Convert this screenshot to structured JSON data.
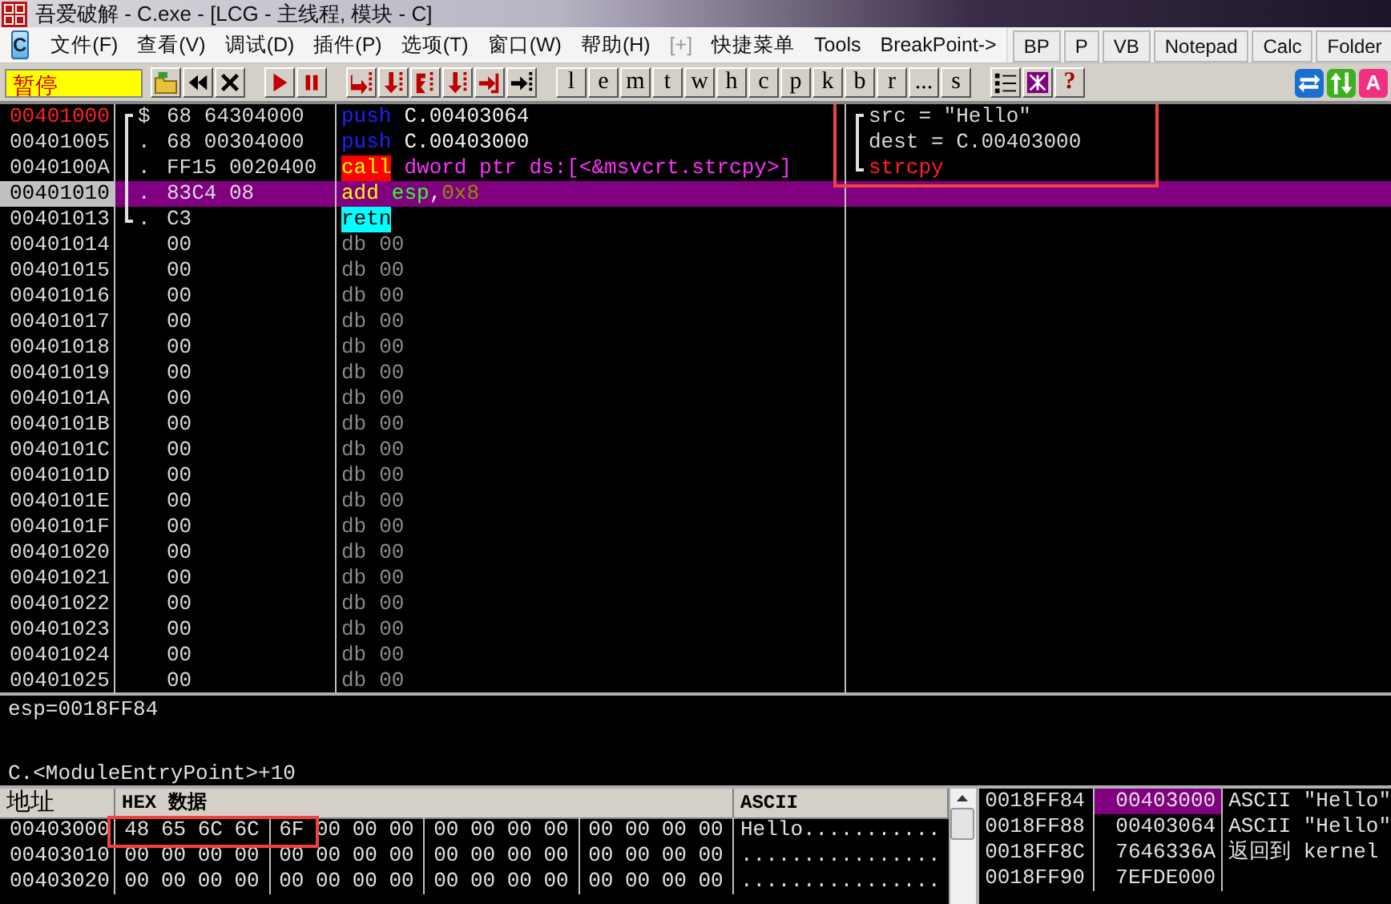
{
  "window": {
    "title": "吾爱破解 - C.exe - [LCG -  主线程, 模块 - C]"
  },
  "menu": {
    "app_icon": "C",
    "items": [
      {
        "label": "文件(F)",
        "disabled": false
      },
      {
        "label": "查看(V)",
        "disabled": false
      },
      {
        "label": "调试(D)",
        "disabled": false
      },
      {
        "label": "插件(P)",
        "disabled": false
      },
      {
        "label": "选项(T)",
        "disabled": false
      },
      {
        "label": "窗口(W)",
        "disabled": false
      },
      {
        "label": "帮助(H)",
        "disabled": false
      },
      {
        "label": "[+]",
        "disabled": true
      },
      {
        "label": "快捷菜单",
        "disabled": false
      },
      {
        "label": "Tools",
        "disabled": false
      },
      {
        "label": "BreakPoint->",
        "disabled": false
      }
    ]
  },
  "quick_buttons": [
    "BP",
    "P",
    "VB",
    "Notepad",
    "Calc",
    "Folder"
  ],
  "toolbar": {
    "status": "暂停",
    "groups": [
      [
        {
          "kind": "open"
        },
        {
          "kind": "restart"
        },
        {
          "kind": "close"
        }
      ],
      [
        {
          "kind": "run"
        },
        {
          "kind": "pause"
        }
      ],
      [
        {
          "kind": "step_into"
        },
        {
          "kind": "step_over"
        },
        {
          "kind": "trace_into"
        },
        {
          "kind": "trace_over"
        },
        {
          "kind": "till_return"
        },
        {
          "kind": "goto"
        }
      ],
      [
        {
          "kind": "letter",
          "label": "l"
        },
        {
          "kind": "letter",
          "label": "e"
        },
        {
          "kind": "letter",
          "label": "m"
        },
        {
          "kind": "letter",
          "label": "t"
        },
        {
          "kind": "letter",
          "label": "w"
        },
        {
          "kind": "letter",
          "label": "h"
        },
        {
          "kind": "letter",
          "label": "c"
        },
        {
          "kind": "letter",
          "label": "p"
        },
        {
          "kind": "letter",
          "label": "k"
        },
        {
          "kind": "letter",
          "label": "b"
        },
        {
          "kind": "letter",
          "label": "r"
        },
        {
          "kind": "letter",
          "label": "..."
        },
        {
          "kind": "letter",
          "label": "s"
        }
      ],
      [
        {
          "kind": "list"
        },
        {
          "kind": "grid"
        },
        {
          "kind": "help",
          "label": "?"
        }
      ]
    ],
    "right_icons": [
      {
        "kind": "swap"
      },
      {
        "kind": "updown"
      },
      {
        "kind": "badge",
        "label": "A"
      }
    ]
  },
  "disassembly": {
    "rows": [
      {
        "address": "00401000",
        "marked": true,
        "selected": false,
        "bracket": {
          "kind": "top"
        },
        "marker": "$",
        "hex": "68 64304000",
        "tokens": [
          {
            "text": "push",
            "kind": "push"
          },
          {
            "text": "C.00403064",
            "kind": "operand"
          }
        ],
        "comment": {
          "text": "src = \"Hello\"",
          "kind": "arg",
          "bracket": {
            "kind": "top"
          }
        }
      },
      {
        "address": "00401005",
        "marked": false,
        "selected": false,
        "bracket": {
          "kind": "middle"
        },
        "marker": ".",
        "hex": "68 00304000",
        "tokens": [
          {
            "text": "push",
            "kind": "push"
          },
          {
            "text": "C.00403000",
            "kind": "operand"
          }
        ],
        "comment": {
          "text": "dest = C.00403000",
          "kind": "arg",
          "bracket": {
            "kind": "middle"
          }
        }
      },
      {
        "address": "0040100A",
        "marked": false,
        "selected": false,
        "bracket": {
          "kind": "middle"
        },
        "marker": ".",
        "hex": "FF15 0020400",
        "tokens": [
          {
            "text": "call",
            "kind": "call"
          },
          {
            "text": "dword ptr ds:[<&msvcrt.strcpy>]",
            "kind": "api"
          }
        ],
        "comment": {
          "text": "strcpy",
          "kind": "call",
          "bracket": {
            "kind": "bottom"
          }
        }
      },
      {
        "address": "00401010",
        "marked": false,
        "selected": true,
        "bracket": {
          "kind": "middle"
        },
        "marker": ".",
        "hex": "83C4 08",
        "tokens": [
          {
            "text": "add",
            "kind": "arith"
          },
          {
            "text": "esp",
            "kind": "register"
          },
          {
            "text": ",",
            "kind": "operand"
          },
          {
            "text": "0x8",
            "kind": "immediate"
          }
        ]
      },
      {
        "address": "00401013",
        "marked": false,
        "selected": false,
        "bracket": {
          "kind": "bottom"
        },
        "marker": ".",
        "hex": "C3",
        "tokens": [
          {
            "text": "retn",
            "kind": "return"
          }
        ]
      },
      {
        "address": "00401014",
        "marked": false,
        "selected": false,
        "hex": "00",
        "tokens": [
          {
            "text": "db",
            "kind": "data"
          },
          {
            "text": "00",
            "kind": "data"
          }
        ]
      },
      {
        "address": "00401015",
        "marked": false,
        "selected": false,
        "hex": "00",
        "tokens": [
          {
            "text": "db",
            "kind": "data"
          },
          {
            "text": "00",
            "kind": "data"
          }
        ]
      },
      {
        "address": "00401016",
        "marked": false,
        "selected": false,
        "hex": "00",
        "tokens": [
          {
            "text": "db",
            "kind": "data"
          },
          {
            "text": "00",
            "kind": "data"
          }
        ]
      },
      {
        "address": "00401017",
        "marked": false,
        "selected": false,
        "hex": "00",
        "tokens": [
          {
            "text": "db",
            "kind": "data"
          },
          {
            "text": "00",
            "kind": "data"
          }
        ]
      },
      {
        "address": "00401018",
        "marked": false,
        "selected": false,
        "hex": "00",
        "tokens": [
          {
            "text": "db",
            "kind": "data"
          },
          {
            "text": "00",
            "kind": "data"
          }
        ]
      },
      {
        "address": "00401019",
        "marked": false,
        "selected": false,
        "hex": "00",
        "tokens": [
          {
            "text": "db",
            "kind": "data"
          },
          {
            "text": "00",
            "kind": "data"
          }
        ]
      },
      {
        "address": "0040101A",
        "marked": false,
        "selected": false,
        "hex": "00",
        "tokens": [
          {
            "text": "db",
            "kind": "data"
          },
          {
            "text": "00",
            "kind": "data"
          }
        ]
      },
      {
        "address": "0040101B",
        "marked": false,
        "selected": false,
        "hex": "00",
        "tokens": [
          {
            "text": "db",
            "kind": "data"
          },
          {
            "text": "00",
            "kind": "data"
          }
        ]
      },
      {
        "address": "0040101C",
        "marked": false,
        "selected": false,
        "hex": "00",
        "tokens": [
          {
            "text": "db",
            "kind": "data"
          },
          {
            "text": "00",
            "kind": "data"
          }
        ]
      },
      {
        "address": "0040101D",
        "marked": false,
        "selected": false,
        "hex": "00",
        "tokens": [
          {
            "text": "db",
            "kind": "data"
          },
          {
            "text": "00",
            "kind": "data"
          }
        ]
      },
      {
        "address": "0040101E",
        "marked": false,
        "selected": false,
        "hex": "00",
        "tokens": [
          {
            "text": "db",
            "kind": "data"
          },
          {
            "text": "00",
            "kind": "data"
          }
        ]
      },
      {
        "address": "0040101F",
        "marked": false,
        "selected": false,
        "hex": "00",
        "tokens": [
          {
            "text": "db",
            "kind": "data"
          },
          {
            "text": "00",
            "kind": "data"
          }
        ]
      },
      {
        "address": "00401020",
        "marked": false,
        "selected": false,
        "hex": "00",
        "tokens": [
          {
            "text": "db",
            "kind": "data"
          },
          {
            "text": "00",
            "kind": "data"
          }
        ]
      },
      {
        "address": "00401021",
        "marked": false,
        "selected": false,
        "hex": "00",
        "tokens": [
          {
            "text": "db",
            "kind": "data"
          },
          {
            "text": "00",
            "kind": "data"
          }
        ]
      },
      {
        "address": "00401022",
        "marked": false,
        "selected": false,
        "hex": "00",
        "tokens": [
          {
            "text": "db",
            "kind": "data"
          },
          {
            "text": "00",
            "kind": "data"
          }
        ]
      },
      {
        "address": "00401023",
        "marked": false,
        "selected": false,
        "hex": "00",
        "tokens": [
          {
            "text": "db",
            "kind": "data"
          },
          {
            "text": "00",
            "kind": "data"
          }
        ]
      },
      {
        "address": "00401024",
        "marked": false,
        "selected": false,
        "hex": "00",
        "tokens": [
          {
            "text": "db",
            "kind": "data"
          },
          {
            "text": "00",
            "kind": "data"
          }
        ]
      },
      {
        "address": "00401025",
        "marked": false,
        "selected": false,
        "hex": "00",
        "tokens": [
          {
            "text": "db",
            "kind": "data"
          },
          {
            "text": "00",
            "kind": "data"
          }
        ]
      }
    ]
  },
  "info": [
    "esp=0018FF84",
    "C.<ModuleEntryPoint>+10"
  ],
  "dump": {
    "columns": [
      "地址",
      "HEX 数据",
      "ASCII"
    ],
    "rows": [
      {
        "address": "00403000",
        "bytes": [
          "48",
          "65",
          "6C",
          "6C",
          "6F",
          "00",
          "00",
          "00",
          "00",
          "00",
          "00",
          "00",
          "00",
          "00",
          "00",
          "00"
        ],
        "ascii": "Hello..........."
      },
      {
        "address": "00403010",
        "bytes": [
          "00",
          "00",
          "00",
          "00",
          "00",
          "00",
          "00",
          "00",
          "00",
          "00",
          "00",
          "00",
          "00",
          "00",
          "00",
          "00"
        ],
        "ascii": "................"
      },
      {
        "address": "00403020",
        "bytes": [
          "00",
          "00",
          "00",
          "00",
          "00",
          "00",
          "00",
          "00",
          "00",
          "00",
          "00",
          "00",
          "00",
          "00",
          "00",
          "00"
        ],
        "ascii": "................"
      }
    ]
  },
  "stack": {
    "rows": [
      {
        "address": "0018FF84",
        "value": "00403000",
        "comment": "ASCII \"Hello\"",
        "selected": true
      },
      {
        "address": "0018FF88",
        "value": "00403064",
        "comment": "ASCII \"Hello\"",
        "selected": false
      },
      {
        "address": "0018FF8C",
        "value": "7646336A",
        "comment": "返回到 kernel",
        "selected": false
      },
      {
        "address": "0018FF90",
        "value": "7EFDE000",
        "selected": false
      }
    ]
  }
}
